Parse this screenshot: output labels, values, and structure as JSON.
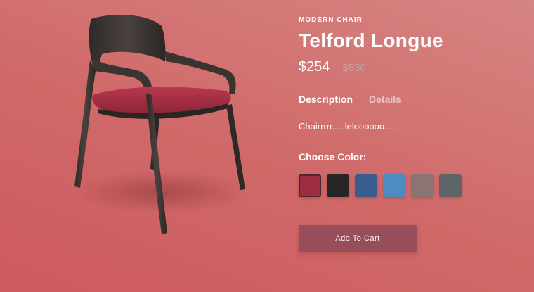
{
  "product": {
    "category": "MODERN CHAIR",
    "name": "Telford Longue",
    "price": "$254",
    "old_price": "$530",
    "image_icon": "chair-illustration"
  },
  "tabs": [
    {
      "label": "Description",
      "active": true
    },
    {
      "label": "Details",
      "active": false
    }
  ],
  "description": "Chairrrrr.....leloooooo.....",
  "colors": {
    "label": "Choose Color:",
    "options": [
      {
        "name": "red",
        "hex": "#9e2d42",
        "selected": true
      },
      {
        "name": "black",
        "hex": "#262628",
        "selected": false
      },
      {
        "name": "navy",
        "hex": "#3a5d8f",
        "selected": false
      },
      {
        "name": "light-blue",
        "hex": "#4e8bc0",
        "selected": false
      },
      {
        "name": "taupe",
        "hex": "#8a7474",
        "selected": false
      },
      {
        "name": "slate-gray",
        "hex": "#5f6467",
        "selected": false
      }
    ]
  },
  "cart_button": "Add To Cart"
}
